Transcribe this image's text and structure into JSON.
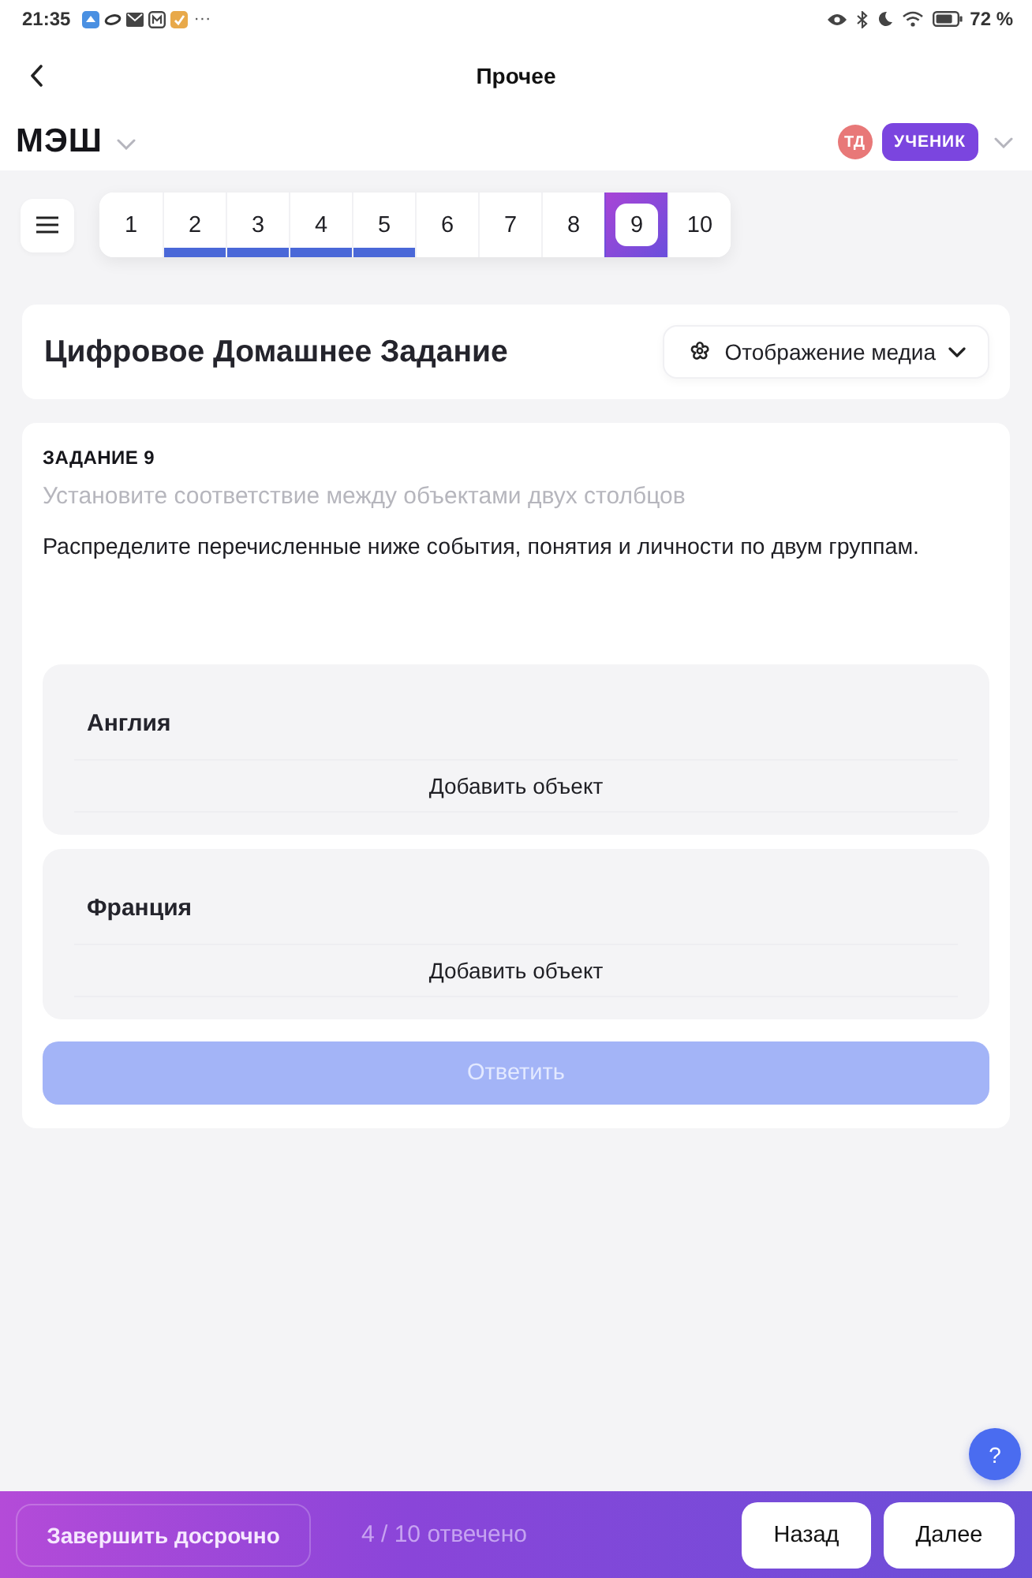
{
  "status_bar": {
    "time": "21:35",
    "more": "···",
    "battery": "72 %"
  },
  "header": {
    "title": "Прочее"
  },
  "brand": {
    "logo": "МЭШ",
    "avatar": "ТД",
    "role": "УЧЕНИК"
  },
  "pager": [
    {
      "label": "1",
      "answered": false,
      "selected": false
    },
    {
      "label": "2",
      "answered": true,
      "selected": false
    },
    {
      "label": "3",
      "answered": true,
      "selected": false
    },
    {
      "label": "4",
      "answered": true,
      "selected": false
    },
    {
      "label": "5",
      "answered": true,
      "selected": false
    },
    {
      "label": "6",
      "answered": false,
      "selected": false
    },
    {
      "label": "7",
      "answered": false,
      "selected": false
    },
    {
      "label": "8",
      "answered": false,
      "selected": false
    },
    {
      "label": "9",
      "answered": false,
      "selected": true
    },
    {
      "label": "10",
      "answered": false,
      "selected": false
    }
  ],
  "assignment": {
    "title": "Цифровое Домашнее Задание",
    "media_button": "Отображение медиа"
  },
  "task": {
    "label": "ЗАДАНИЕ 9",
    "hint": "Установите соответствие между объектами двух столбцов",
    "instruction": "Распределите перечисленные ниже события, понятия и личности по двум группам.",
    "groups": [
      {
        "title": "Англия",
        "add_label": "Добавить объект"
      },
      {
        "title": "Франция",
        "add_label": "Добавить объект"
      }
    ],
    "submit": {
      "label": "Ответить",
      "disabled": true
    }
  },
  "help": "?",
  "footer": {
    "finish": "Завершить досрочно",
    "progress": "4 / 10 отвечено",
    "back": "Назад",
    "next": "Далее"
  }
}
